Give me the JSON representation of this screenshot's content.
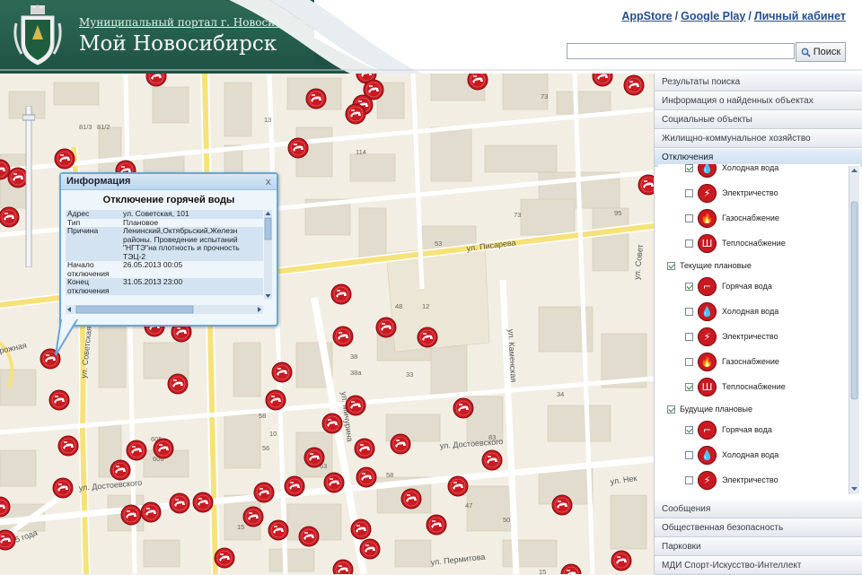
{
  "header": {
    "portal_subtitle": "Муниципальный портал г. Новосибирска",
    "portal_title": "Мой Новосибирск",
    "links": [
      "AppStore",
      "Google Play",
      "Личный кабинет"
    ],
    "search": {
      "value": "",
      "button_label": "Поиск"
    }
  },
  "map": {
    "streets": [
      "ул. Писарева",
      "ул. Советская",
      "ул. Мичурина",
      "ул. Каменская",
      "ул. Достоевского",
      "ул. Достоевского",
      "ул. Нек",
      "ул. Пермитова",
      "ул. Совет",
      "1905 года",
      "рожная"
    ],
    "building_numbers": [
      "81/3",
      "81/2",
      "114",
      "53",
      "73",
      "95",
      "13",
      "26",
      "73",
      "38",
      "38а",
      "48",
      "12",
      "33",
      "34",
      "83",
      "605",
      "606",
      "58",
      "10",
      "56",
      "15",
      "63",
      "58",
      "54",
      "47",
      "50",
      "105",
      "15"
    ],
    "popup": {
      "header": "Информация",
      "close_label": "x",
      "title": "Отключение горячей воды",
      "rows": [
        {
          "key": "Адрес",
          "value": "ул. Советская, 101"
        },
        {
          "key": "Тип",
          "value": "Плановое"
        },
        {
          "key": "Причина",
          "value": "Ленинский,Октябрьский,Железн\nрайоны. Проведение испытаний\n\"НГТЭ\"на плотность и прочность\nТЭЦ-2"
        },
        {
          "key": "Начало\nотключения",
          "value": "26.05.2013 00:05"
        },
        {
          "key": "Конец\nотключения",
          "value": "31.05.2013 23:00"
        }
      ]
    }
  },
  "panel": {
    "accordion_top": [
      "Результаты поиска",
      "Информация о найденных объектах",
      "Социальные объекты",
      "Жилищно-коммунальное хозяйство",
      "Отключения"
    ],
    "accordion_bottom": [
      "Сообщения",
      "Общественная безопасность",
      "Парковки",
      "МДИ Спорт-Искусство-Интеллект"
    ],
    "list": [
      {
        "kind": "item",
        "label": "Холодная вода",
        "checked": true,
        "icon": "water-drop"
      },
      {
        "kind": "item",
        "label": "Электричество",
        "checked": false,
        "icon": "lightning"
      },
      {
        "kind": "item",
        "label": "Газоснабжение",
        "checked": false,
        "icon": "flame"
      },
      {
        "kind": "item",
        "label": "Теплоснабжение",
        "checked": false,
        "icon": "radiator"
      },
      {
        "kind": "group",
        "label": "Текущие плановые",
        "checked": true
      },
      {
        "kind": "item",
        "label": "Горячая вода",
        "checked": true,
        "icon": "faucet"
      },
      {
        "kind": "item",
        "label": "Холодная вода",
        "checked": false,
        "icon": "water-drop"
      },
      {
        "kind": "item",
        "label": "Электричество",
        "checked": false,
        "icon": "lightning"
      },
      {
        "kind": "item",
        "label": "Газоснабжение",
        "checked": false,
        "icon": "flame"
      },
      {
        "kind": "item",
        "label": "Теплоснабжение",
        "checked": true,
        "icon": "radiator"
      },
      {
        "kind": "group",
        "label": "Будущие плановые",
        "checked": true
      },
      {
        "kind": "item",
        "label": "Горячая вода",
        "checked": true,
        "icon": "faucet"
      },
      {
        "kind": "item",
        "label": "Холодная вода",
        "checked": false,
        "icon": "water-drop"
      },
      {
        "kind": "item",
        "label": "Электричество",
        "checked": false,
        "icon": "lightning"
      }
    ]
  },
  "colors": {
    "marker": "#c91a22",
    "header_green": "#1f5244",
    "link_blue": "#274e86",
    "panel_active": "#cfdff0"
  }
}
